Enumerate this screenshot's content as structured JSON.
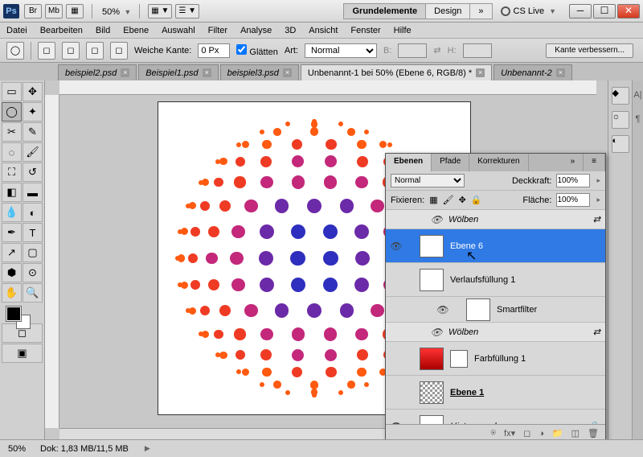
{
  "title": {
    "zoom": "50%"
  },
  "titlebar_btns": [
    "Br",
    "Mb",
    "▦"
  ],
  "essentials": {
    "a": "Grundelemente",
    "b": "Design",
    "more": "»",
    "cs": "CS Live"
  },
  "menu": [
    "Datei",
    "Bearbeiten",
    "Bild",
    "Ebene",
    "Auswahl",
    "Filter",
    "Analyse",
    "3D",
    "Ansicht",
    "Fenster",
    "Hilfe"
  ],
  "opt": {
    "feather": "Weiche Kante:",
    "featherv": "0 Px",
    "aa": "Glätten",
    "style": "Art:",
    "stylev": "Normal",
    "b": "B:",
    "h": "H:",
    "refine": "Kante verbessern..."
  },
  "tabs": [
    {
      "label": "beispiel2.psd",
      "active": false
    },
    {
      "label": "Beispiel1.psd",
      "active": false
    },
    {
      "label": "beispiel3.psd",
      "active": false
    },
    {
      "label": "Unbenannt-1 bei 50% (Ebene 6, RGB/8) *",
      "active": true
    },
    {
      "label": "Unbenannt-2",
      "active": false
    }
  ],
  "layers": {
    "tabs": [
      "Ebenen",
      "Pfade",
      "Korrekturen"
    ],
    "blend": "Normal",
    "opacity_l": "Deckkraft:",
    "opacity": "100%",
    "lock_l": "Fixieren:",
    "fill_l": "Fläche:",
    "fill": "100%",
    "items": [
      {
        "type": "sub",
        "name": "Wölben",
        "vis": true
      },
      {
        "type": "layer",
        "name": "Ebene 6",
        "vis": true,
        "sel": true,
        "thumb": "dots"
      },
      {
        "type": "layer",
        "name": "Verlaufsfüllung 1",
        "vis": false,
        "thumb": "dots-sm"
      },
      {
        "type": "layer",
        "name": "Smartfilter",
        "vis": true,
        "thumb": "white",
        "indent": true
      },
      {
        "type": "sub",
        "name": "Wölben",
        "vis": true
      },
      {
        "type": "layer",
        "name": "Farbfüllung 1",
        "vis": false,
        "thumb": "grad",
        "mask": true
      },
      {
        "type": "layer",
        "name": "Ebene 1",
        "vis": false,
        "thumb": "chk",
        "bold": true
      },
      {
        "type": "layer",
        "name": "Hintergrund",
        "vis": true,
        "thumb": "white",
        "italic": true,
        "lock": true
      }
    ]
  },
  "status": {
    "zoom": "50%",
    "doc": "Dok: 1,83 MB/11,5 MB"
  }
}
